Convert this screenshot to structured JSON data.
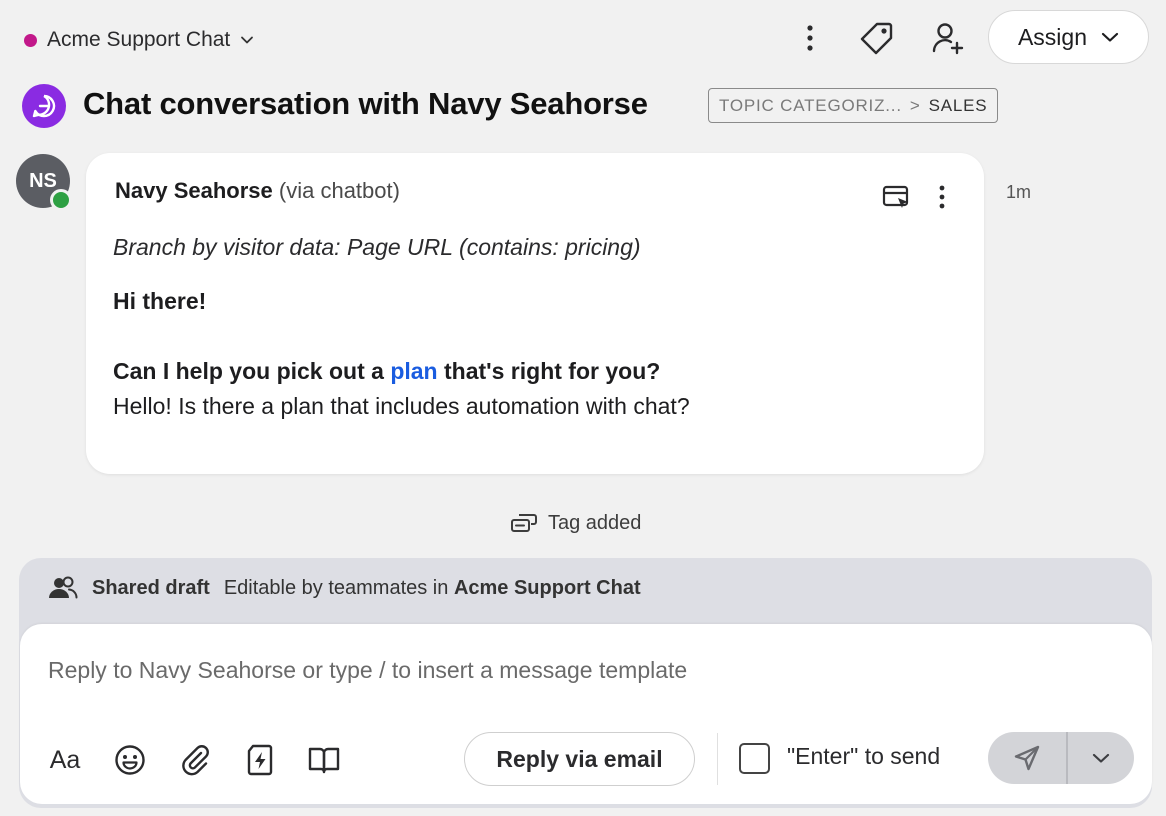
{
  "topbar": {
    "inbox_name": "Acme Support Chat",
    "assign_label": "Assign"
  },
  "conversation": {
    "title": "Chat conversation with Navy Seahorse",
    "topic_parent": "TOPIC CATEGORIZ...",
    "topic_separator": ">",
    "topic_child": "SALES"
  },
  "message": {
    "avatar_initials": "NS",
    "sender_name": "Navy Seahorse",
    "sender_via": "(via chatbot)",
    "timestamp": "1m",
    "branch_note": "Branch by visitor data: Page URL (contains: pricing)",
    "greeting": "Hi there!",
    "question_before": "Can I help you pick out a ",
    "question_link": "plan",
    "question_after": " that's right for you?",
    "visitor_reply": "Hello! Is there a plan that includes automation with chat?"
  },
  "event": {
    "text": "Tag added"
  },
  "draft": {
    "label": "Shared draft",
    "editable_prefix": "Editable by teammates in",
    "inbox_name": "Acme Support Chat"
  },
  "composer": {
    "placeholder": "Reply to Navy Seahorse or type / to insert a message template",
    "value": "",
    "format_label": "Aa",
    "reply_email_label": "Reply via email",
    "enter_to_send_label": "\"Enter\" to send",
    "enter_to_send_checked": false
  },
  "colors": {
    "inbox_dot": "#c2188a",
    "conversation_icon": "#8a2be2",
    "presence_online": "#2ea043",
    "link": "#1a5ce0"
  },
  "icons": [
    "kebab-menu-icon",
    "tag-icon",
    "add-person-icon",
    "chevron-down-icon",
    "chat-bubble-icon",
    "open-window-icon",
    "tag-added-icon",
    "people-icon",
    "emoji-icon",
    "paperclip-icon",
    "quick-action-icon",
    "knowledge-book-icon",
    "send-icon"
  ]
}
